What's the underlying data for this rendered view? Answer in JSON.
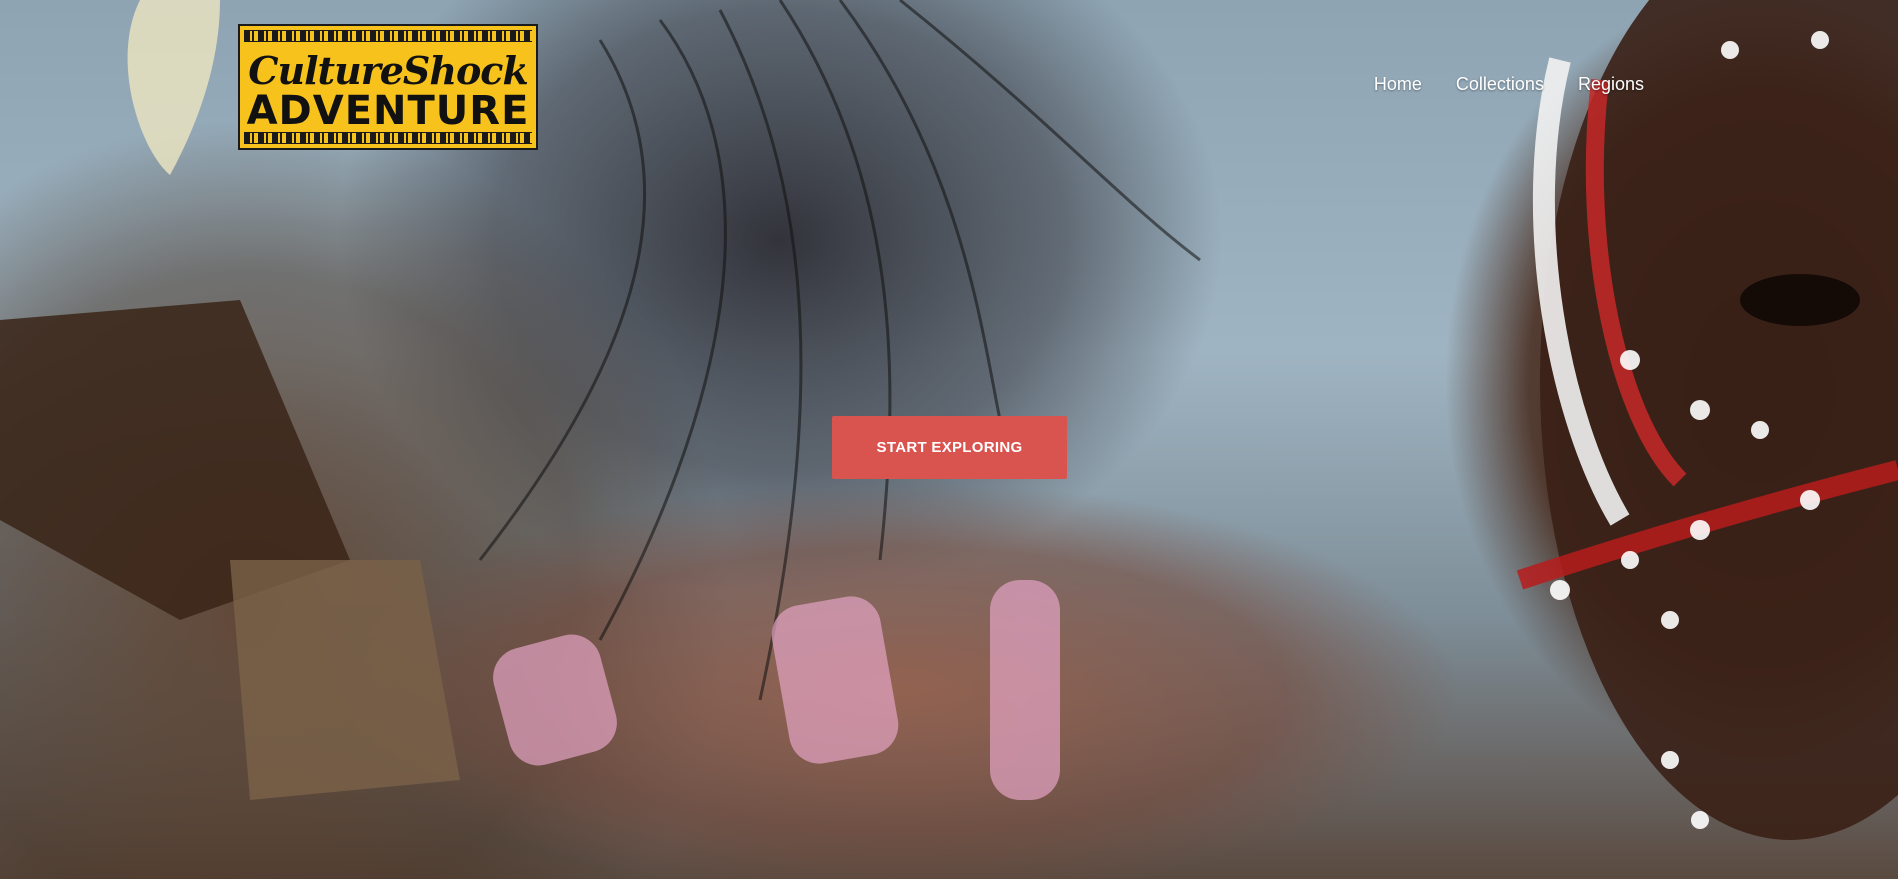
{
  "logo": {
    "line1": "CultureShock",
    "line2": "ADVENTURE"
  },
  "nav": {
    "items": [
      {
        "label": "Home"
      },
      {
        "label": "Collections"
      },
      {
        "label": "Regions"
      }
    ]
  },
  "hero": {
    "cta_label": "START EXPLORING"
  },
  "colors": {
    "logo_bg": "#f7c21b",
    "cta_bg": "#d9534f",
    "nav_text": "#ffffff"
  }
}
